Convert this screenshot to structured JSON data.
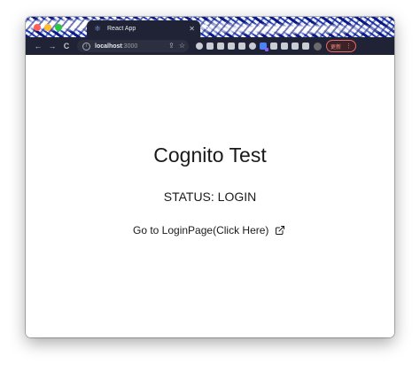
{
  "browser": {
    "tab": {
      "title": "React App",
      "favicon": "react-atom-icon",
      "close_icon": "✕"
    },
    "new_tab_icon": "+",
    "toolbar": {
      "back_icon": "←",
      "forward_icon": "→",
      "reload_icon": "C",
      "url_host": "localhost",
      "url_port": ":3000",
      "update_label": "更新",
      "menu_icon": "⋮"
    },
    "colors": {
      "tab_bg": "#1f2335",
      "update_border": "#e66b6b",
      "close_red": "#ff5f57",
      "minimize_yellow": "#febc2e",
      "maximize_green": "#28c840"
    }
  },
  "page": {
    "heading": "Cognito Test",
    "status": "STATUS: LOGIN",
    "link_text": "Go to LoginPage(Click Here)",
    "link_icon": "external-link-icon"
  }
}
